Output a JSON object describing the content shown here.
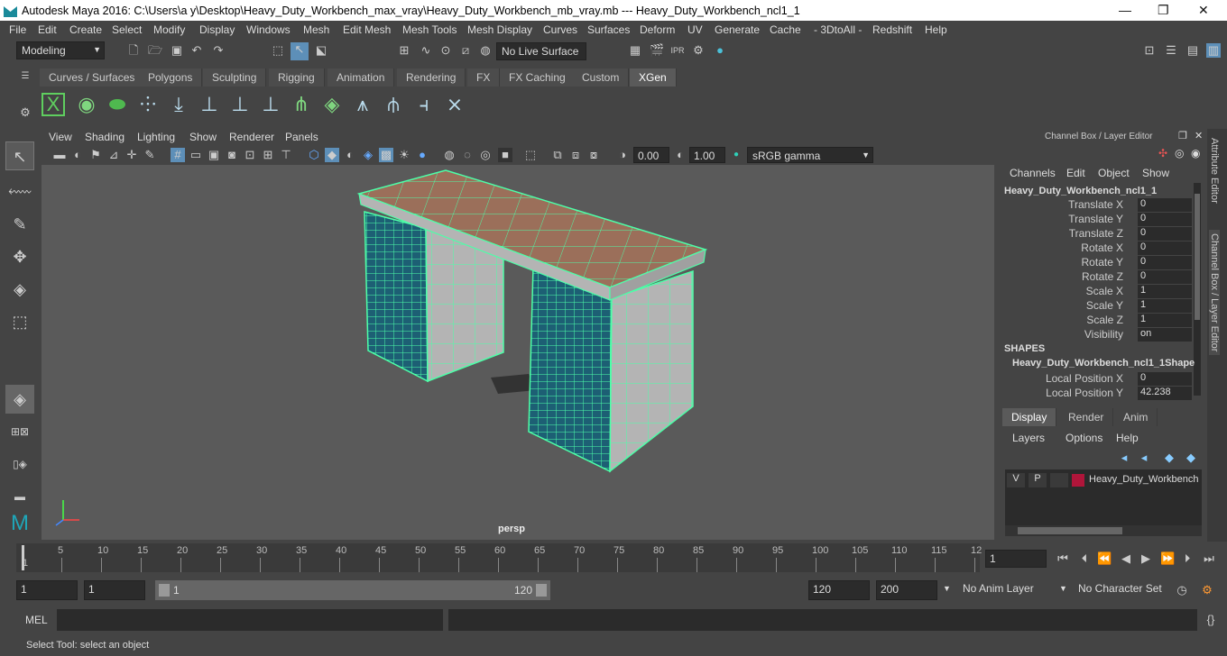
{
  "titlebar": {
    "title": "Autodesk Maya 2016: C:\\Users\\a y\\Desktop\\Heavy_Duty_Workbench_max_vray\\Heavy_Duty_Workbench_mb_vray.mb   ---   Heavy_Duty_Workbench_ncl1_1",
    "minimize": "—",
    "maximize": "❐",
    "close": "✕"
  },
  "menu": [
    "File",
    "Edit",
    "Create",
    "Select",
    "Modify",
    "Display",
    "Windows",
    "Mesh",
    "Edit Mesh",
    "Mesh Tools",
    "Mesh Display",
    "Curves",
    "Surfaces",
    "Deform",
    "UV",
    "Generate",
    "Cache",
    "- 3DtoAll -",
    "Redshift",
    "Help"
  ],
  "status": {
    "mode": "Modeling",
    "live_surface": "No Live Surface"
  },
  "shelf_tabs": [
    "Curves / Surfaces",
    "Polygons",
    "Sculpting",
    "Rigging",
    "Animation",
    "Rendering",
    "FX",
    "FX Caching",
    "Custom",
    "XGen"
  ],
  "active_shelf": "XGen",
  "viewport": {
    "menu": [
      "View",
      "Shading",
      "Lighting",
      "Show",
      "Renderer",
      "Panels"
    ],
    "exposure": "0.00",
    "gamma": "1.00",
    "color_space": "sRGB gamma",
    "camera": "persp"
  },
  "channel_box": {
    "title": "Channel Box / Layer Editor",
    "menu": [
      "Channels",
      "Edit",
      "Object",
      "Show"
    ],
    "object": "Heavy_Duty_Workbench_ncl1_1",
    "attrs": [
      {
        "label": "Translate X",
        "value": "0"
      },
      {
        "label": "Translate Y",
        "value": "0"
      },
      {
        "label": "Translate Z",
        "value": "0"
      },
      {
        "label": "Rotate X",
        "value": "0"
      },
      {
        "label": "Rotate Y",
        "value": "0"
      },
      {
        "label": "Rotate Z",
        "value": "0"
      },
      {
        "label": "Scale X",
        "value": "1"
      },
      {
        "label": "Scale Y",
        "value": "1"
      },
      {
        "label": "Scale Z",
        "value": "1"
      },
      {
        "label": "Visibility",
        "value": "on"
      }
    ],
    "shapes_header": "SHAPES",
    "shape_name": "Heavy_Duty_Workbench_ncl1_1Shape",
    "shape_attrs": [
      {
        "label": "Local Position X",
        "value": "0"
      },
      {
        "label": "Local Position Y",
        "value": "42.238"
      }
    ],
    "layer_tabs": [
      "Display",
      "Render",
      "Anim"
    ],
    "layer_menu": [
      "Layers",
      "Options",
      "Help"
    ],
    "layer": {
      "v": "V",
      "p": "P",
      "name": "Heavy_Duty_Workbench",
      "color": "#b0153a"
    }
  },
  "side_tabs": [
    "Attribute Editor",
    "Channel Box / Layer Editor"
  ],
  "timeline": {
    "ticks": [
      "5",
      "10",
      "15",
      "20",
      "25",
      "30",
      "35",
      "40",
      "45",
      "50",
      "55",
      "60",
      "65",
      "70",
      "75",
      "80",
      "85",
      "90",
      "95",
      "100",
      "105",
      "110",
      "115",
      "12"
    ],
    "first": "1",
    "current_frame": "1"
  },
  "range": {
    "start": "1",
    "anim_start": "1",
    "slider_start": "1",
    "slider_end": "120",
    "end": "120",
    "anim_end": "200",
    "anim_layer": "No Anim Layer",
    "char_set": "No Character Set"
  },
  "cmd": {
    "label": "MEL"
  },
  "help": "Select Tool: select an object",
  "colors": {
    "wire": "#4dffa8",
    "top": "#9b6f5a",
    "side": "#b0b0b0",
    "drawer": "#1d5f74"
  }
}
